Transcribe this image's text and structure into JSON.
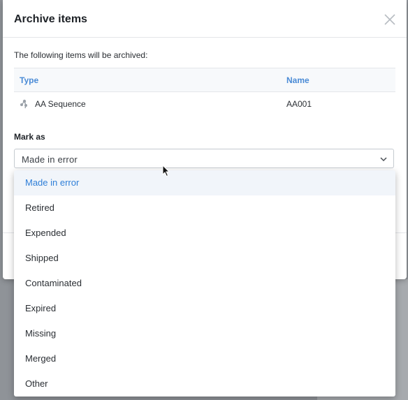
{
  "modal": {
    "title": "Archive items",
    "intro": "The following items will be archived:",
    "table": {
      "headers": [
        "Type",
        "Name"
      ],
      "rows": [
        {
          "type": "AA Sequence",
          "name": "AA001",
          "icon": "aa-sequence-icon"
        }
      ]
    },
    "mark_label": "Mark as",
    "select_value": "Made in error"
  },
  "dropdown": {
    "options": [
      "Made in error",
      "Retired",
      "Expended",
      "Shipped",
      "Contaminated",
      "Expired",
      "Missing",
      "Merged",
      "Other"
    ],
    "selected": "Made in error"
  },
  "colors": {
    "accent": "#4a8bd6",
    "selected_text": "#2f7fd8",
    "overlay": "#8f9398"
  }
}
